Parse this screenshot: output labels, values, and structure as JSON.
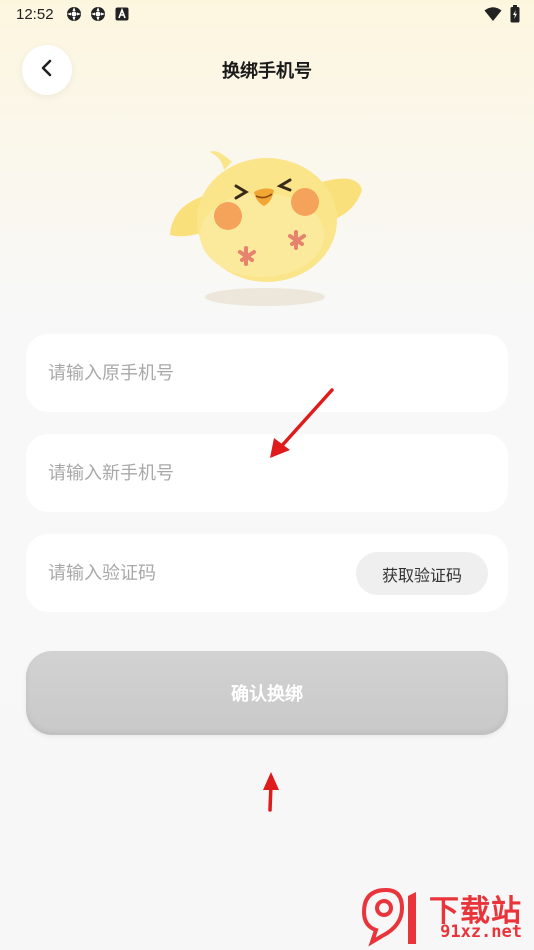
{
  "status_bar": {
    "time": "12:52",
    "left_icons": [
      "gear-notification-icon",
      "gear-notification-icon",
      "a-box-icon"
    ],
    "right_icons": [
      "wifi-icon",
      "battery-icon"
    ]
  },
  "header": {
    "back_icon": "chevron-left-icon",
    "title": "换绑手机号"
  },
  "form": {
    "old_phone_placeholder": "请输入原手机号",
    "new_phone_placeholder": "请输入新手机号",
    "code_placeholder": "请输入验证码",
    "get_code_label": "获取验证码",
    "confirm_label": "确认换绑"
  },
  "watermark": {
    "line1": "下载站",
    "line2": "91xz.net",
    "logo": "91-logo"
  },
  "colors": {
    "arrow": "#e01b1b",
    "watermark": "#e8343a",
    "confirm_disabled": "#cccccc"
  }
}
